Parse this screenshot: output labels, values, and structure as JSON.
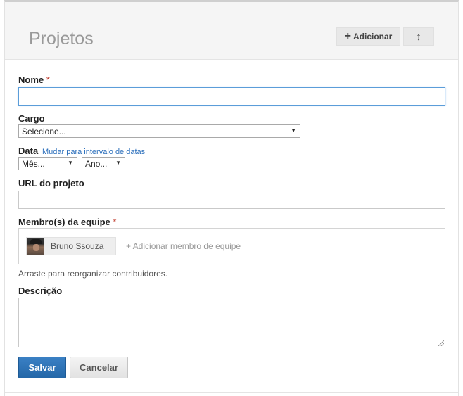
{
  "header": {
    "title": "Projetos",
    "add_label": "Adicionar",
    "add_icon": "+",
    "sort_icon": "↕"
  },
  "form": {
    "name": {
      "label": "Nome",
      "required_mark": "*",
      "value": ""
    },
    "role": {
      "label": "Cargo",
      "selected": "Selecione..."
    },
    "date": {
      "label": "Data",
      "range_link": "Mudar para intervalo de datas",
      "month_selected": "Mês...",
      "year_selected": "Ano..."
    },
    "url": {
      "label": "URL do projeto",
      "value": ""
    },
    "members": {
      "label": "Membro(s) da equipe",
      "required_mark": "*",
      "chips": [
        {
          "name": "Bruno Ssouza"
        }
      ],
      "add_placeholder": "+ Adicionar membro de equipe",
      "hint": "Arraste para reorganizar contribuidores."
    },
    "description": {
      "label": "Descrição",
      "value": ""
    },
    "save_label": "Salvar",
    "cancel_label": "Cancelar"
  },
  "colors": {
    "primary": "#2a6ebb",
    "required": "#c0392b",
    "focus": "#5b9dd9"
  }
}
